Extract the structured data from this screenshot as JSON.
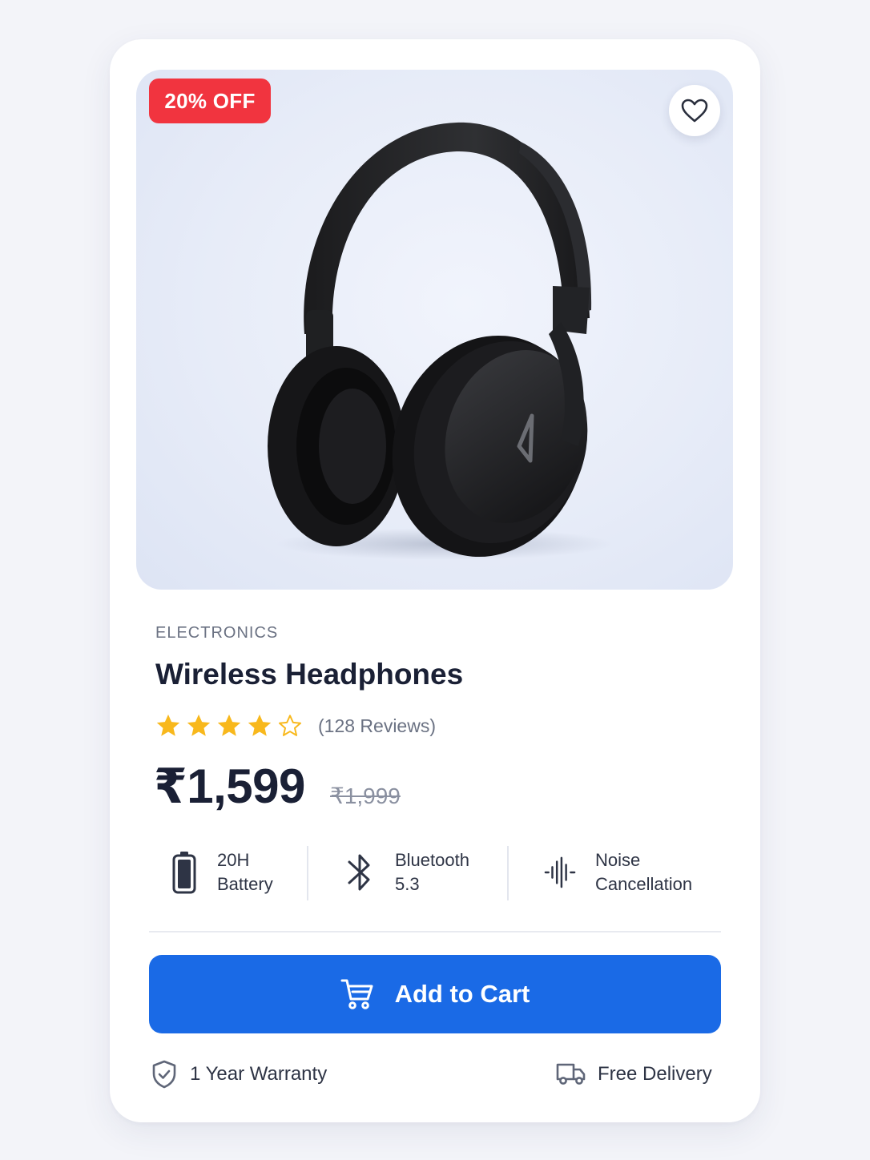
{
  "badge": {
    "text": "20% OFF",
    "color": "#f1343f"
  },
  "wishlist": {
    "icon": "heart-icon"
  },
  "product": {
    "category": "ELECTRONICS",
    "title": "Wireless Headphones",
    "rating": {
      "value": 4,
      "max": 5,
      "reviews_text": "(128 Reviews)"
    },
    "price": "₹1,599",
    "original_price": "₹1,999"
  },
  "features": [
    {
      "icon": "battery-icon",
      "line1": "20H",
      "line2": "Battery"
    },
    {
      "icon": "bluetooth-icon",
      "line1": "Bluetooth",
      "line2": "5.3"
    },
    {
      "icon": "sound-wave-icon",
      "line1": "Noise",
      "line2": "Cancellation"
    }
  ],
  "cart_button": {
    "label": "Add to Cart",
    "icon": "cart-icon",
    "color": "#1a6ae6"
  },
  "footer": {
    "warranty": {
      "icon": "shield-check-icon",
      "text": "1 Year Warranty"
    },
    "delivery": {
      "icon": "truck-icon",
      "text": "Free Delivery"
    }
  },
  "colors": {
    "star": "#f8b81c",
    "text_dark": "#1a2035",
    "text_muted": "#6b7283"
  }
}
